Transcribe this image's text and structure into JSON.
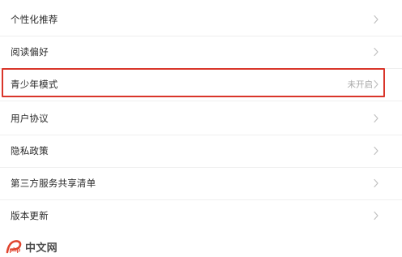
{
  "settings_list": {
    "items": [
      {
        "label": "个性化推荐",
        "status": ""
      },
      {
        "label": "阅读偏好",
        "status": ""
      },
      {
        "label": "青少年模式",
        "status": "未开启"
      },
      {
        "label": "用户协议",
        "status": ""
      },
      {
        "label": "隐私政策",
        "status": ""
      },
      {
        "label": "第三方服务共享清单",
        "status": ""
      },
      {
        "label": "版本更新",
        "status": ""
      }
    ]
  },
  "watermark": {
    "text": "中文网",
    "logo_text": "php"
  },
  "colors": {
    "highlight": "#d9352a",
    "label": "#2a2a2a",
    "status": "#a8a8a8",
    "chevron": "#c0c0c0",
    "separator": "#efefef"
  },
  "icons": {
    "row_chevron": "chevron-right-icon",
    "watermark_logo": "php-logo-icon"
  }
}
